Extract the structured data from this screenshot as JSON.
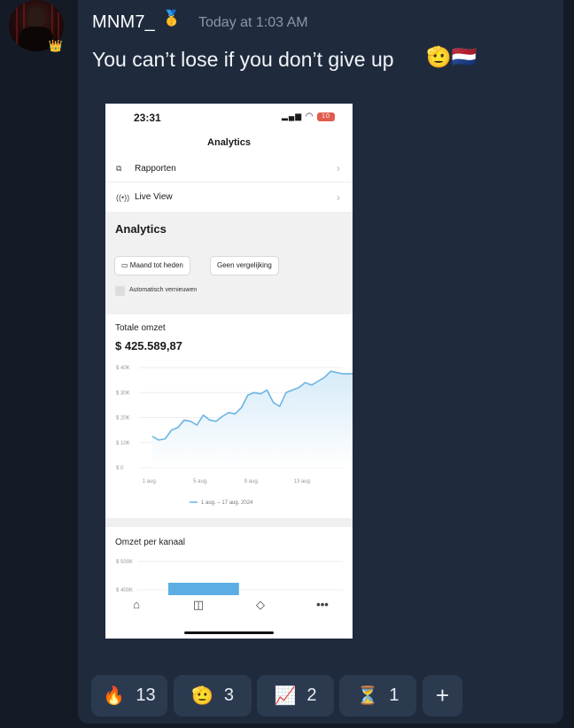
{
  "message": {
    "username": "MNM7_",
    "timestamp": "Today at 1:03 AM",
    "text": "You can’t lose if you don’t give up",
    "trailing_emojis": "🫡🇳🇱",
    "badge_emoji": "🥇",
    "crown_emoji": "👑"
  },
  "screenshot": {
    "status_time": "23:31",
    "battery": "10",
    "header_title": "Analytics",
    "rows": [
      {
        "label": "Rapporten",
        "icon": "report-icon"
      },
      {
        "label": "Live View",
        "icon": "live-view-icon"
      }
    ],
    "analytics_title": "Analytics",
    "pill_period": "Maand tot heden",
    "pill_compare": "Geen vergelijking",
    "auto_refresh": "Automatisch vernieuwen",
    "total_label": "Totale omzet",
    "total_value": "$ 425.589,87",
    "channel_label": "Omzet per kanaal",
    "channel_ticks": [
      "$ 500K",
      "$ 400K"
    ],
    "channel_bar_fraction": 0.42,
    "legend": "1 aug. – 17 aug. 2024"
  },
  "chart_data": {
    "type": "area",
    "title": "",
    "xlabel": "",
    "ylabel": "",
    "x_tick_labels": [
      "1 aug.",
      "5 aug.",
      "9 aug.",
      "13 aug."
    ],
    "y_tick_labels": [
      "$ 40K",
      "$ 30K",
      "$ 20K",
      "$ 10K",
      "$ 0"
    ],
    "ylim": [
      0,
      40000
    ],
    "xlim": [
      1,
      17
    ],
    "grid": true,
    "legend_position": "bottom",
    "series": [
      {
        "name": "1 aug. – 17 aug. 2024",
        "color": "#6cb4e4",
        "x": [
          1,
          1.5,
          2,
          2.5,
          3,
          3.5,
          4,
          4.5,
          5,
          5.5,
          6,
          6.5,
          7,
          7.5,
          8,
          8.5,
          9,
          9.5,
          10,
          10.5,
          11,
          11.5,
          12,
          12.5,
          13,
          13.5,
          14,
          14.5,
          15,
          15.5,
          16,
          16.5,
          17
        ],
        "y": [
          12500,
          11000,
          11500,
          15000,
          16000,
          19000,
          18500,
          17000,
          21000,
          19000,
          18500,
          20500,
          22000,
          21500,
          24000,
          29000,
          30000,
          29500,
          31000,
          26000,
          24500,
          30000,
          31000,
          32000,
          34000,
          33000,
          34500,
          36000,
          38500,
          38000,
          37500,
          37500,
          37500
        ]
      }
    ]
  },
  "reactions": [
    {
      "emoji": "🔥",
      "count": "13"
    },
    {
      "emoji": "🫡",
      "count": "3"
    },
    {
      "emoji": "📈",
      "count": "2"
    },
    {
      "emoji": "⏳",
      "count": "1"
    }
  ],
  "add_reaction": "+"
}
